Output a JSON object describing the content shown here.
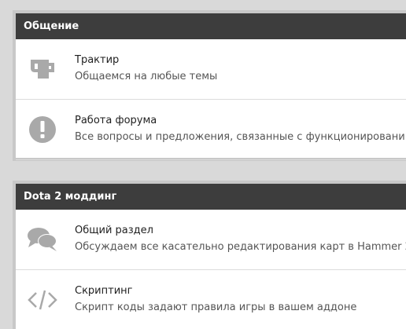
{
  "categories": [
    {
      "title": "Общение",
      "forums": [
        {
          "title": "Трактир",
          "description": "Общаемся на любые темы",
          "icon": "beer-mug-icon"
        },
        {
          "title": "Работа форума",
          "description": "Все вопросы и предложения, связанные с функционировани",
          "icon": "exclamation-circle-icon"
        }
      ]
    },
    {
      "title": "Dota 2 моддинг",
      "forums": [
        {
          "title": "Общий раздел",
          "description": "Обсуждаем все касательно редактирования карт в Hammer 2",
          "icon": "chat-bubbles-icon"
        },
        {
          "title": "Скриптинг",
          "description": "Скрипт коды задают правила игры в вашем аддоне",
          "icon": "code-brackets-icon"
        }
      ]
    }
  ],
  "colors": {
    "header_bg": "#3d3d3d",
    "icon_gray": "#a9a9a9",
    "page_bg": "#d9d9d9"
  }
}
